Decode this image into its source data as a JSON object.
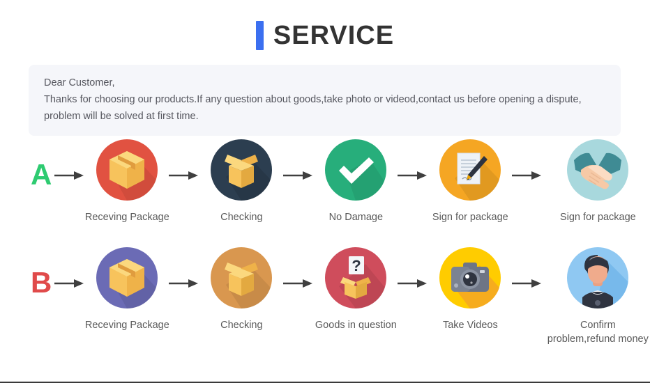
{
  "header": {
    "accent_color": "#3b6ff0",
    "title": "SERVICE"
  },
  "notice": {
    "background": "#f5f6fa",
    "line1": "Dear Customer,",
    "line2": "Thanks for choosing our products.If any question about goods,take photo or videod,contact us before opening a dispute,",
    "line3": "problem will be solved at first time."
  },
  "flows": [
    {
      "letter": "A",
      "letter_color": "#2ecb71",
      "steps": [
        {
          "label": "Receving Package",
          "icon": "package-box-icon",
          "circle_color": "#e15241"
        },
        {
          "label": "Checking",
          "icon": "open-box-icon",
          "circle_color": "#2c3e50"
        },
        {
          "label": "No Damage",
          "icon": "check-mark-icon",
          "circle_color": "#27ae7b"
        },
        {
          "label": "Sign for package",
          "icon": "document-pen-icon",
          "circle_color": "#f5a623"
        },
        {
          "label": "Sign for package",
          "icon": "handshake-icon",
          "circle_color": "#a8d8dd"
        }
      ]
    },
    {
      "letter": "B",
      "letter_color": "#e04a4a",
      "steps": [
        {
          "label": "Receving Package",
          "icon": "package-box-icon",
          "circle_color": "#6b6bb5"
        },
        {
          "label": "Checking",
          "icon": "open-box-icon",
          "circle_color": "#d9974f"
        },
        {
          "label": "Goods in question",
          "icon": "question-box-icon",
          "circle_color": "#cf4d5c"
        },
        {
          "label": "Take Videos",
          "icon": "camera-icon",
          "circle_color": "#ffcc00"
        },
        {
          "label": "Confirm problem,refund money",
          "icon": "person-avatar-icon",
          "circle_color": "#8fc8f2"
        }
      ]
    }
  ],
  "arrow": {
    "name": "arrow-right-icon",
    "color": "#3f3f3f"
  }
}
